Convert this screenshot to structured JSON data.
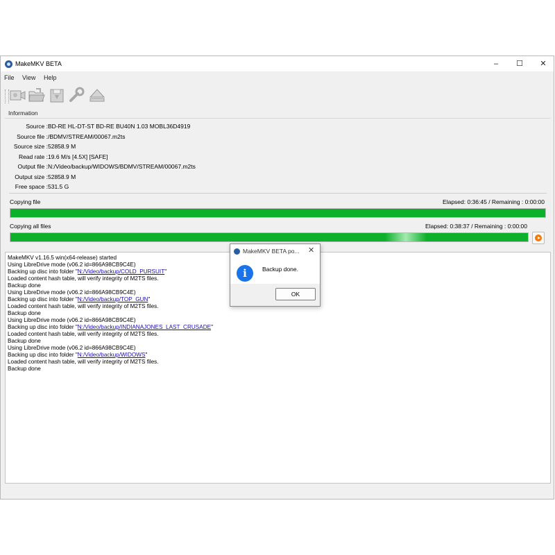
{
  "window": {
    "title": "MakeMKV BETA",
    "minimize": "–",
    "maximize": "☐",
    "close": "✕"
  },
  "menu": [
    "File",
    "View",
    "Help"
  ],
  "toolbar": {
    "buttons": [
      {
        "name": "open-disc",
        "icon": "camera-disc-icon"
      },
      {
        "name": "open-files",
        "icon": "folder-icon"
      },
      {
        "name": "backup",
        "icon": "backup-disk-icon"
      },
      {
        "name": "preferences",
        "icon": "wrench-icon"
      },
      {
        "name": "eject",
        "icon": "eject-icon"
      }
    ]
  },
  "info": {
    "group_title": "Information",
    "rows": [
      {
        "label": "Source :",
        "value": "BD-RE HL-DT-ST BD-RE BU40N 1.03 MOBL36D4919"
      },
      {
        "label": "Source file :",
        "value": "/BDMV/STREAM/00067.m2ts"
      },
      {
        "label": "Source size :",
        "value": "52858.9 M"
      },
      {
        "label": "Read rate :",
        "value": "19.6 M/s [4.5X] [SAFE]"
      },
      {
        "label": "Output file :",
        "value": "N:/Video/backup/WIDOWS/BDMV/STREAM/00067.m2ts"
      },
      {
        "label": "Output size :",
        "value": "52858.9 M"
      },
      {
        "label": "Free space :",
        "value": "531.5 G"
      }
    ]
  },
  "progress": {
    "file": {
      "label": "Copying file",
      "status": "Elapsed: 0:36:45 / Remaining : 0:00:00",
      "fraction": 1.0
    },
    "all": {
      "label": "Copying all files",
      "status": "Elapsed: 0:38:37 / Remaining : 0:00:00",
      "fraction": 1.0
    }
  },
  "log": [
    {
      "text": "MakeMKV v1.16.5 win(x64-release) started"
    },
    {
      "text": "Using LibreDrive mode (v06.2 id=866A98CB9C4E)"
    },
    {
      "pre": "Backing up disc into folder \"",
      "link": "N:/Video/backup/COLD_PURSUIT",
      "post": "\""
    },
    {
      "text": "Loaded content hash table, will verify integrity of M2TS files."
    },
    {
      "text": "Backup done"
    },
    {
      "text": "Using LibreDrive mode (v06.2 id=866A98CB9C4E)"
    },
    {
      "pre": "Backing up disc into folder \"",
      "link": "N:/Video/backup/TOP_GUN",
      "post": "\""
    },
    {
      "text": "Loaded content hash table, will verify integrity of M2TS files."
    },
    {
      "text": "Backup done"
    },
    {
      "text": "Using LibreDrive mode (v06.2 id=866A98CB9C4E)"
    },
    {
      "pre": "Backing up disc into folder \"",
      "link": "N:/Video/backup/INDIANAJONES_LAST_CRUSADE",
      "post": "\""
    },
    {
      "text": "Loaded content hash table, will verify integrity of M2TS files."
    },
    {
      "text": "Backup done"
    },
    {
      "text": "Using LibreDrive mode (v06.2 id=866A98CB9C4E)"
    },
    {
      "pre": "Backing up disc into folder \"",
      "link": "N:/Video/backup/WIDOWS",
      "post": "\""
    },
    {
      "text": "Loaded content hash table, will verify integrity of M2TS files."
    },
    {
      "text": "Backup done"
    }
  ],
  "dialog": {
    "title": "MakeMKV BETA po...",
    "message": "Backup done.",
    "ok_label": "OK",
    "close": "✕",
    "icon": "info-icon"
  },
  "colors": {
    "progress_fill": "#0cb02a",
    "link": "#1a0dab",
    "info_icon": "#1a73e8",
    "stop_button": "#f07a0c"
  }
}
